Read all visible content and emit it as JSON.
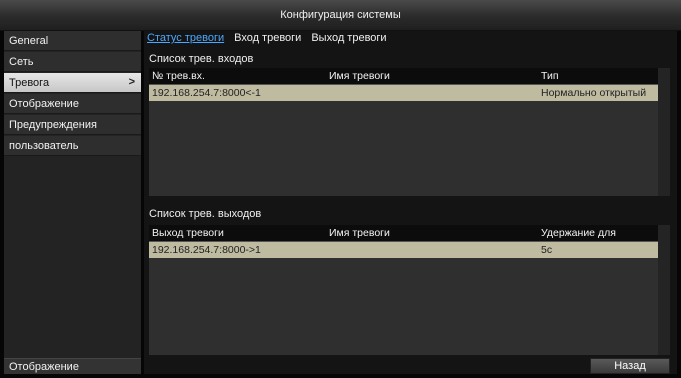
{
  "window": {
    "title": "Конфигурация системы"
  },
  "sidebar": {
    "items": [
      {
        "label": "General"
      },
      {
        "label": "Сеть"
      },
      {
        "label": "Тревога",
        "chevron": ">"
      },
      {
        "label": "Отображение"
      },
      {
        "label": "Предупреждения"
      },
      {
        "label": "пользователь"
      }
    ],
    "active": "Тревога",
    "bottom_label": "Отображение"
  },
  "tabs": [
    {
      "label": "Статус тревоги",
      "active": true
    },
    {
      "label": "Вход тревоги"
    },
    {
      "label": "Выход тревоги"
    }
  ],
  "inputs": {
    "title": "Список трев. входов",
    "columns": [
      "№ трев.вх.",
      "Имя тревоги",
      "Тип"
    ],
    "rows": [
      {
        "id": "192.168.254.7:8000<-1",
        "name": "",
        "type": "Нормально открытый"
      }
    ]
  },
  "outputs": {
    "title": "Список трев. выходов",
    "columns": [
      "Выход тревоги",
      "Имя тревоги",
      "Удержание для"
    ],
    "rows": [
      {
        "id": "192.168.254.7:8000->1",
        "name": "",
        "hold": "5с"
      }
    ]
  },
  "buttons": {
    "back": "Назад"
  },
  "colors": {
    "active_tab": "#4aa8ff",
    "selected_row": "#bfbba0",
    "active_sidebar": "#d9d9d9"
  }
}
